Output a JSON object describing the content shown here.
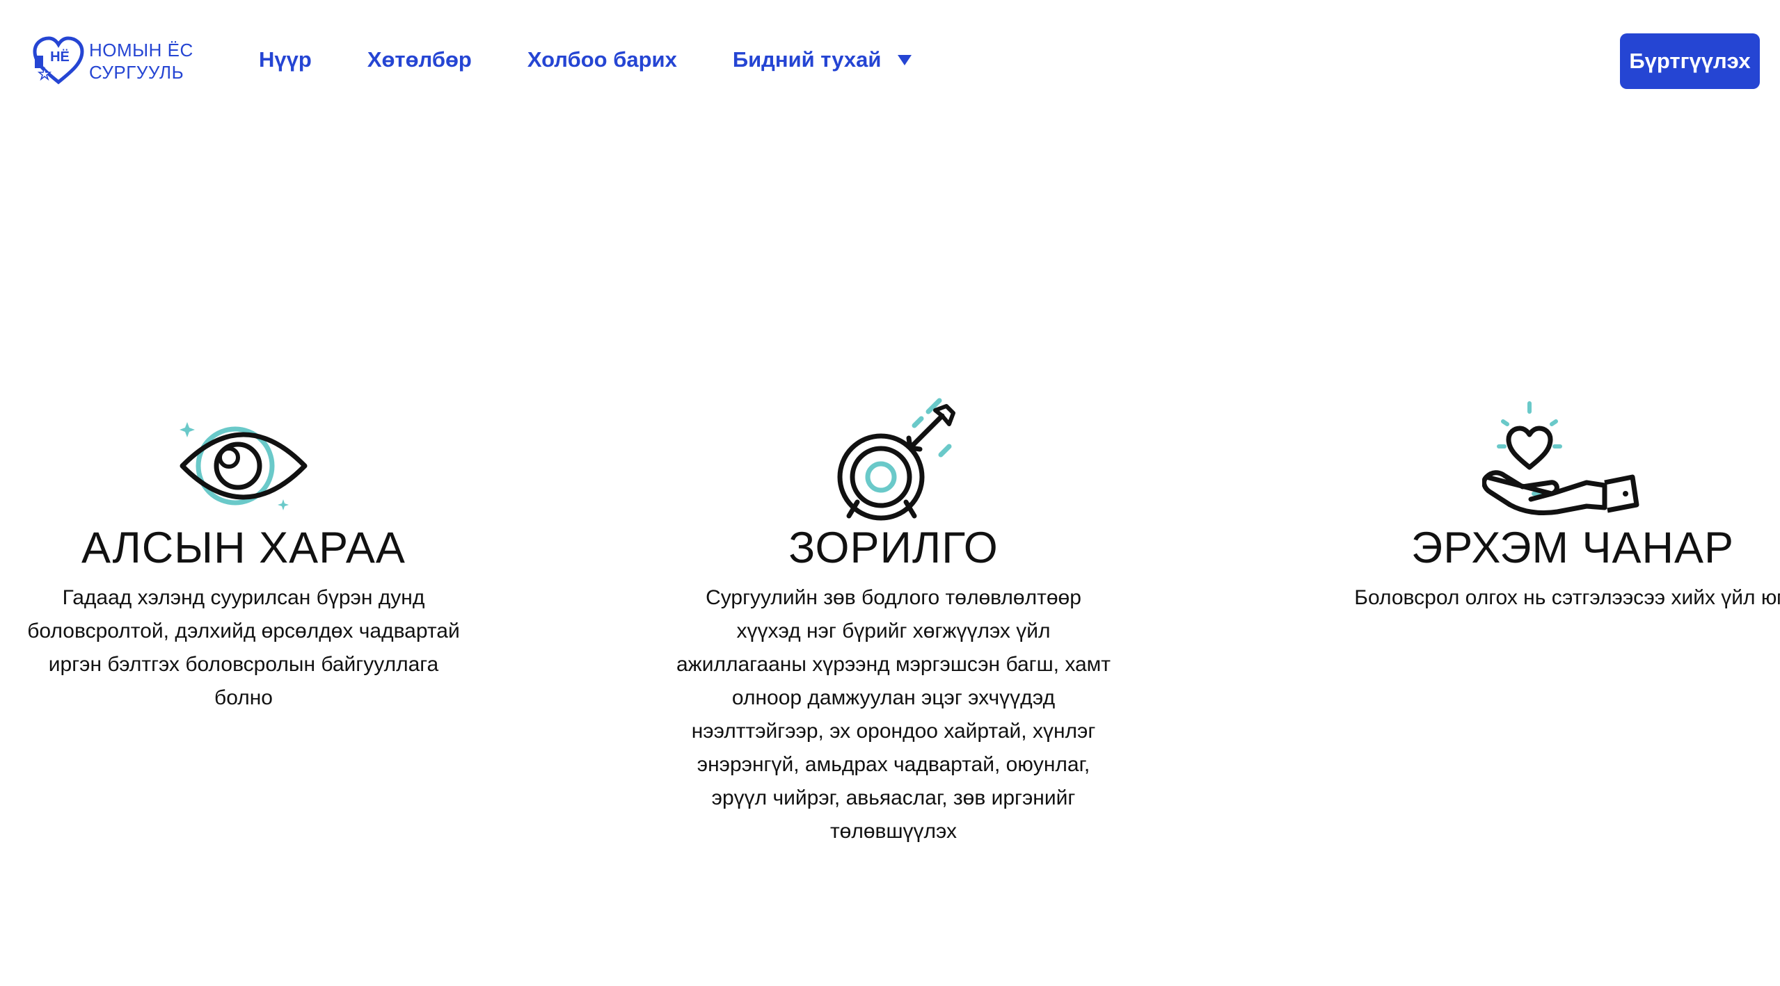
{
  "header": {
    "logo_line1": "НОМЫН ЁС",
    "logo_line2": "СУРГУУЛЬ",
    "logo_mark_text": "НЁ",
    "nav": [
      {
        "label": "Нүүр"
      },
      {
        "label": "Хөтөлбөр"
      },
      {
        "label": "Холбоо барих"
      },
      {
        "label": "Бидний тухай"
      }
    ],
    "register_label": "Бүртгүүлэх"
  },
  "features": [
    {
      "icon": "eye-icon",
      "title": "АЛСЫН ХАРАА",
      "lines": [
        "Гадаад хэлэнд суурилсан бүрэн дунд",
        "боловсролтой, дэлхийд өрсөлдөх чадвартай",
        "иргэн бэлтгэх боловсролын байгууллага",
        "болно"
      ]
    },
    {
      "icon": "target-icon",
      "title": "ЗОРИЛГО",
      "lines": [
        "Сургуулийн зөв бодлого төлөвлөлтөөр",
        "хүүхэд нэг бүрийг хөгжүүлэх үйл",
        "ажиллагааны хүрээнд мэргэшсэн багш, хамт",
        "олноор дамжуулан эцэг эхчүүдэд",
        "нээлттэйгээр, эх орондоо хайртай, хүнлэг",
        "энэрэнгүй, амьдрах чадвартай, оюунлаг,",
        "эрүүл чийрэг, авьяаслаг, зөв иргэнийг",
        "төлөвшүүлэх"
      ]
    },
    {
      "icon": "heart-hand-icon",
      "title": "ЭРХЭМ ЧАНАР",
      "lines": [
        "Боловсрол олгох нь сэтгэлээсээ хийх үйл юм"
      ]
    }
  ],
  "colors": {
    "brand_blue": "#2545d3",
    "accent_teal": "#6ac9c9",
    "text": "#111111",
    "background": "#ffffff"
  }
}
